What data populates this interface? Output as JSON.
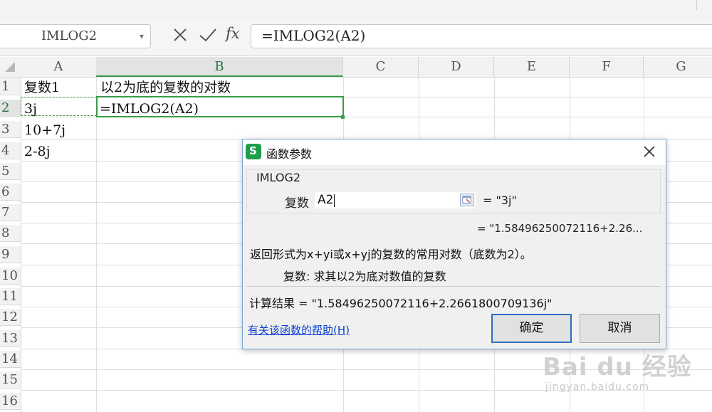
{
  "formula_bar": {
    "name_box": "IMLOG2",
    "formula": "=IMLOG2(A2)",
    "fx_label": "fx"
  },
  "columns": [
    "A",
    "B",
    "C",
    "D",
    "E",
    "F",
    "G"
  ],
  "rows": [
    "1",
    "2",
    "3",
    "4",
    "5",
    "6",
    "7",
    "8",
    "9",
    "10",
    "11",
    "12",
    "13",
    "14",
    "15",
    "16"
  ],
  "cells": {
    "A1": "复数1",
    "B1": "以2为底的复数的对数",
    "A2": "3j",
    "B2": "=IMLOG2(A2)",
    "A3": "10+7j",
    "A4": "2-8j"
  },
  "dialog": {
    "logo": "S",
    "title": "函数参数",
    "function_name": "IMLOG2",
    "arg_label": "复数",
    "arg_value": "A2",
    "arg_evaluated": "= \"3j\"",
    "preview_result": "= \"1.5849625007211​6+2.26...",
    "description": "返回形式为x+yi或x+yj的复数的常用对数（底数为2）。",
    "arg_description": "复数:  求其以2为底对数值的复数",
    "result": "计算结果 = \"1.58496250072116+2.2661800709136j\"",
    "help_link": "有关该函数的帮助(H)",
    "ok_label": "确定",
    "cancel_label": "取消"
  },
  "watermark": {
    "logo": "Bai du 经验",
    "url": "jingyan.baidu.com"
  },
  "colors": {
    "accent_green": "#3c9a4a",
    "link_blue": "#0b3fd0",
    "ok_border": "#2b6fc4"
  }
}
